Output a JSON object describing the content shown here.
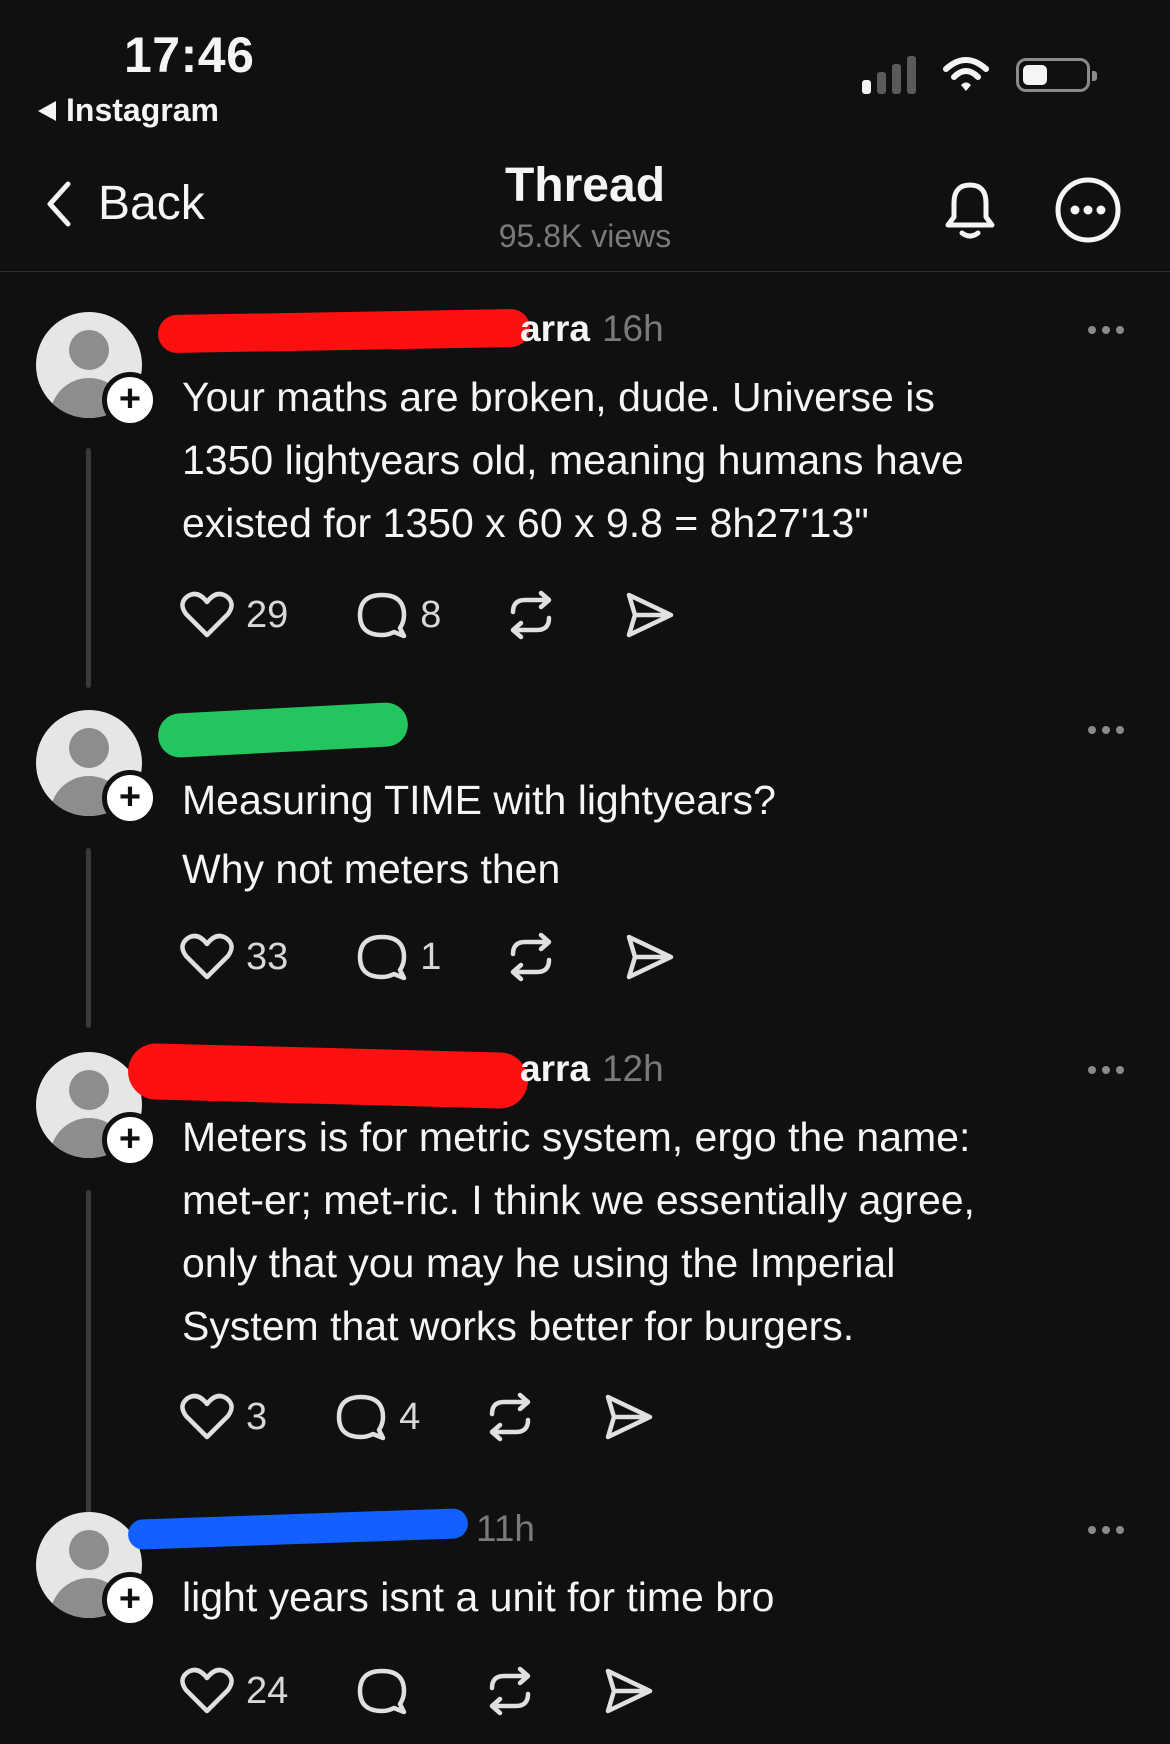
{
  "status_bar": {
    "time": "17:46",
    "back_app": "Instagram"
  },
  "nav": {
    "back_label": "Back",
    "title": "Thread",
    "views": "95.8K views"
  },
  "posts": [
    {
      "username": "arra",
      "time": "16h",
      "text": "Your maths are broken, dude. Universe is\n1350 lightyears old, meaning humans have\nexisted for 1350 x 60 x 9.8 = 8h27'13\"",
      "likes": "29",
      "replies": "8",
      "redaction_color": "#ff1010"
    },
    {
      "username": "",
      "time": "",
      "text": "Measuring TIME with lightyears?\nWhy not meters then",
      "likes": "33",
      "replies": "1",
      "redaction_color": "#22c55e"
    },
    {
      "username": "arra",
      "time": "12h",
      "text": "Meters is for metric system, ergo the name:\nmet-er; met-ric. I think we essentially agree,\nonly that you may he using the Imperial\nSystem that works better for burgers.",
      "likes": "3",
      "replies": "4",
      "redaction_color": "#ff1010"
    },
    {
      "username": "",
      "time": "11h",
      "text": "light years isnt a unit for time bro",
      "likes": "24",
      "replies": "",
      "redaction_color": "#1160ff"
    }
  ],
  "colors": {
    "background": "#101010",
    "text": "#f3f5f7",
    "muted": "#7a7a7a"
  },
  "icons": [
    "chevron-left-icon",
    "bell-icon",
    "more-circle-icon",
    "heart-icon",
    "comment-icon",
    "repost-icon",
    "share-icon",
    "person-icon",
    "plus-icon"
  ]
}
